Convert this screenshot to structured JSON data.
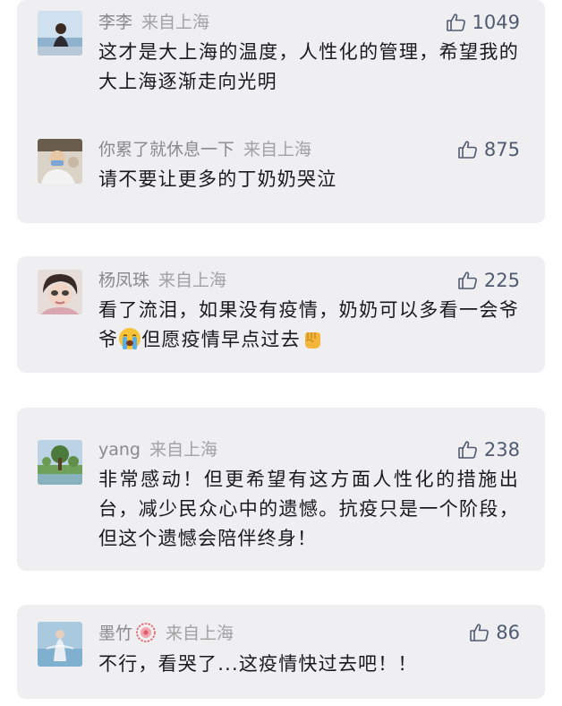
{
  "cards": [
    {
      "comments": [
        {
          "name": "李李",
          "location": "来自上海",
          "likes": "1049",
          "text": "这才是大上海的温度，人性化的管理，希望我的大上海逐渐走向光明"
        },
        {
          "name": "你累了就休息一下",
          "location": "来自上海",
          "likes": "875",
          "text": "请不要让更多的丁奶奶哭泣"
        }
      ]
    },
    {
      "comments": [
        {
          "name": "杨凤珠",
          "location": "来自上海",
          "likes": "225",
          "text_part1": "看了流泪，如果没有疫情，奶奶可以多看一会爷爷",
          "text_part2": "但愿疫情早点过去"
        }
      ]
    },
    {
      "comments": [
        {
          "name": "yang",
          "location": "来自上海",
          "likes": "238",
          "text": "非常感动！但更希望有这方面人性化的措施出台，减少民众心中的遗憾。抗疫只是一个阶段，但这个遗憾会陪伴终身！"
        }
      ]
    },
    {
      "comments": [
        {
          "name": "墨竹",
          "location": "来自上海",
          "likes": "86",
          "text": "不行，看哭了...这疫情快过去吧！！"
        }
      ]
    }
  ],
  "icons": {
    "like": "thumbs-up-icon",
    "crying_emoji": "loudly-crying-face-icon",
    "fist_emoji": "raised-fist-icon",
    "badge": "flower-badge-icon"
  },
  "colors": {
    "card_bg": "#efeff1",
    "meta_text": "#9a9a9a",
    "like_text": "#505a70",
    "body_text": "#1a1a1a"
  }
}
